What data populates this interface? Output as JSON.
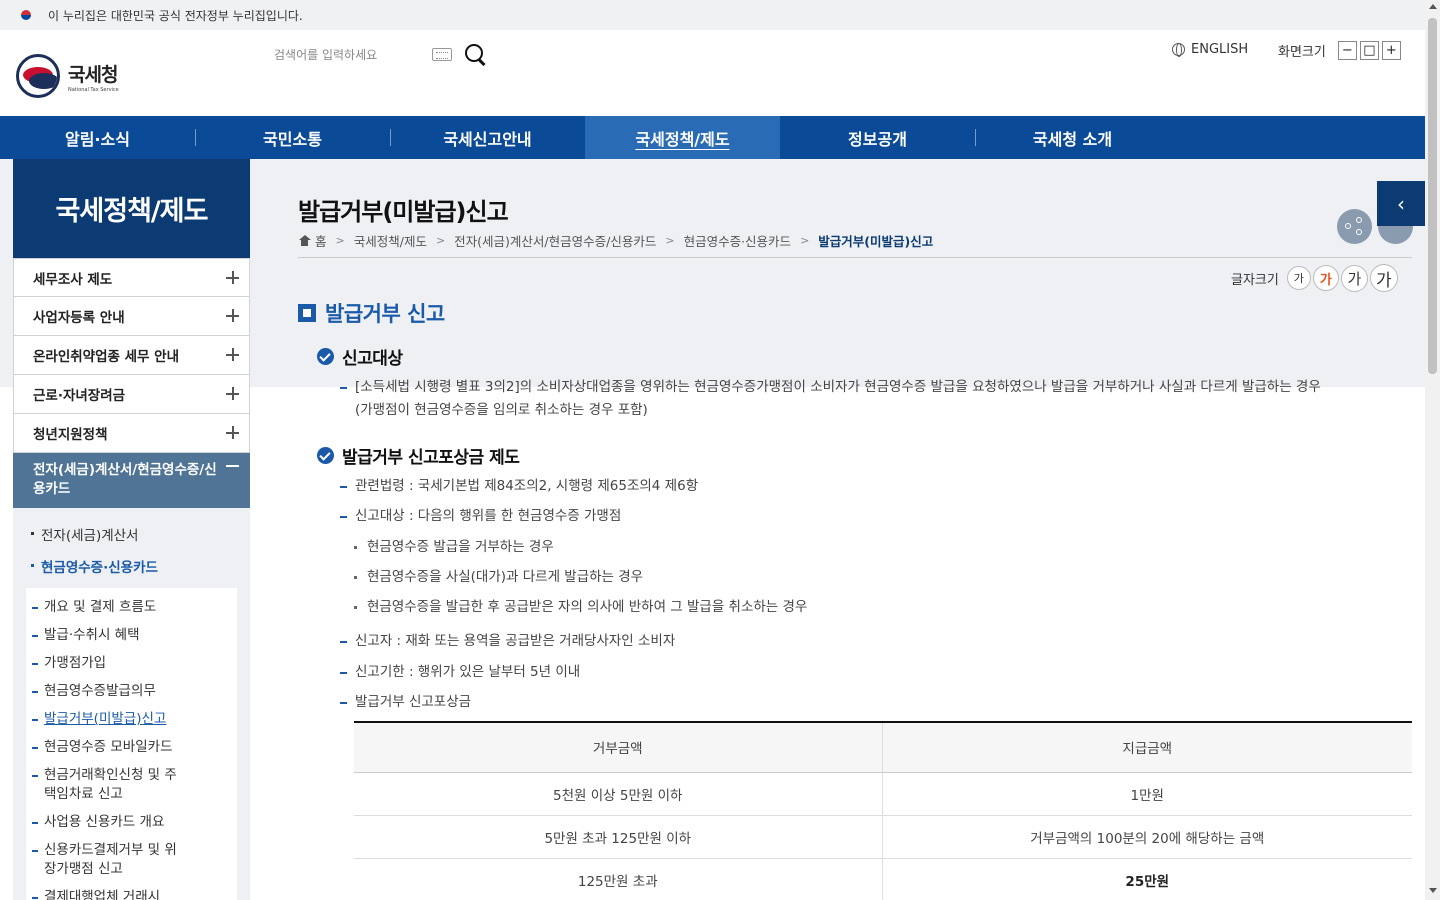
{
  "govbar": {
    "text": "이 누리집은 대한민국 공식 전자정부 누리집입니다."
  },
  "logo": {
    "ko": "국세청",
    "en": "National Tax Service"
  },
  "search": {
    "placeholder": "검색어를 입력하세요"
  },
  "header": {
    "english": "ENGLISH",
    "zoom_label": "화면크기",
    "zoom_out": "−",
    "zoom_reset": "□",
    "zoom_in": "+"
  },
  "gnb": [
    "알림·소식",
    "국민소통",
    "국세신고안내",
    "국세정책/제도",
    "정보공개",
    "국세청 소개"
  ],
  "lnb": {
    "title": "국세정책/제도",
    "items": [
      "세무조사 제도",
      "사업자등록 안내",
      "온라인취약업종 세무 안내",
      "근로·자녀장려금",
      "청년지원정책"
    ],
    "open_item": "전자(세금)계산서/현금영수증/신용카드",
    "sub": [
      "전자(세금)계산서",
      "현금영수증·신용카드"
    ],
    "sub3": [
      "개요 및 결제 흐름도",
      "발급·수취시 혜택",
      "가맹점가입",
      "현금영수증발급의무",
      "발급거부(미발급)신고",
      "현금영수증 모바일카드",
      "현금거래확인신청 및 주택임차료 신고",
      "사업용 신용카드 개요",
      "신용카드결제거부 및 위장가맹점 신고",
      "결제대행업체 거래시"
    ]
  },
  "page": {
    "title": "발급거부(미발급)신고",
    "breadcrumb": [
      "홈",
      "국세정책/제도",
      "전자(세금)계산서/현금영수증/신용카드",
      "현금영수증·신용카드",
      "발급거부(미발급)신고"
    ],
    "font_label": "글자크기",
    "font_btns": [
      "가",
      "가",
      "가",
      "가"
    ]
  },
  "content": {
    "h2": "발급거부 신고",
    "s1_title": "신고대상",
    "s1_text1": "[소득세법 시행령 별표 3의2]의 소비자상대업종을 영위하는 현금영수증가맹점이 소비자가 현금영수증 발급을 요청하였으나 발급을 거부하거나 사실과 다르게 발급하는 경우",
    "s1_text2": "(가맹점이 현금영수증을 임의로 취소하는 경우 포함)",
    "s2_title": "발급거부 신고포상금 제도",
    "law": "관련법령 : 국세기본법 제84조의2, 시행령 제65조의4 제6항",
    "target": "신고대상 : 다음의 행위를 한 현금영수증 가맹점",
    "target_items": [
      "현금영수증 발급을 거부하는 경우",
      "현금영수증을 사실(대가)과 다르게 발급하는 경우",
      "현금영수증을 발급한 후 공급받은 자의 의사에 반하여 그 발급을 취소하는 경우"
    ],
    "reporter": "신고자 : 재화 또는 용역을 공급받은 거래당사자인 소비자",
    "deadline": "신고기한 : 행위가 있은 날부터 5년 이내",
    "reward": "발급거부 신고포상금"
  },
  "table": {
    "headers": [
      "거부금액",
      "지급금액"
    ],
    "rows": [
      [
        "5천원 이상 5만원 이하",
        "1만원"
      ],
      [
        "5만원 초과 125만원 이하",
        "거부금액의 100분의 20에 해당하는 금액"
      ],
      [
        "125만원 초과",
        "25만원"
      ]
    ]
  },
  "colors": {
    "gnb": "#0a4a96",
    "lnb_title": "#0b3b72",
    "accent": "#1a5aa8",
    "lnb_open": "#4f7496"
  }
}
